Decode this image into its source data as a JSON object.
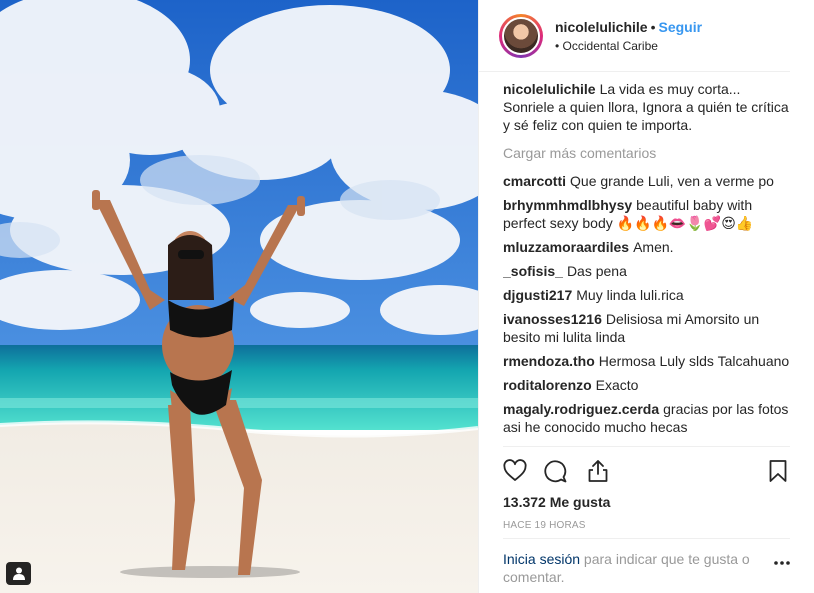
{
  "header": {
    "username": "nicolelulichile",
    "separator": "•",
    "follow_label": "Seguir",
    "location": "• Occidental Caribe"
  },
  "caption": {
    "user": "nicolelulichile",
    "text": "La vida es muy corta... Sonriele a quien llora, Ignora a quién te crítica y sé feliz con quien te importa."
  },
  "load_more": "Cargar más comentarios",
  "comments": [
    {
      "user": "cmarcotti",
      "text": "Que grande Luli, ven a verme po"
    },
    {
      "user": "brhymmhmdlbhysy",
      "text": "beautiful baby with perfect sexy body 🔥🔥🔥👄🌷💕😍👍"
    },
    {
      "user": "mluzzamoraardiles",
      "text": "Amen."
    },
    {
      "user": "_sofisis_",
      "text": "Das pena"
    },
    {
      "user": "djgusti217",
      "text": "Muy linda luli.rica"
    },
    {
      "user": "ivanosses1216",
      "text": "Delisiosa mi Amorsito un besito mi lulita linda"
    },
    {
      "user": "rmendoza.tho",
      "text": "Hermosa Luly slds Talcahuano"
    },
    {
      "user": "roditalorenzo",
      "text": "Exacto"
    },
    {
      "user": "magaly.rodriguez.cerda",
      "text": "gracias por las fotos asi he conocido mucho hecas"
    }
  ],
  "icons": {
    "like": "heart-icon",
    "comment": "comment-bubble-icon",
    "share": "share-icon",
    "save": "bookmark-icon",
    "more": "ellipsis-icon",
    "tag": "person-tag-icon"
  },
  "likes": "13.372 Me gusta",
  "timestamp": "HACE 19 HORAS",
  "login_prompt": {
    "link": "Inicia sesión",
    "text": " para indicar que te gusta o comentar."
  },
  "colors": {
    "follow": "#3897f0",
    "muted": "#999999",
    "link": "#003569"
  }
}
